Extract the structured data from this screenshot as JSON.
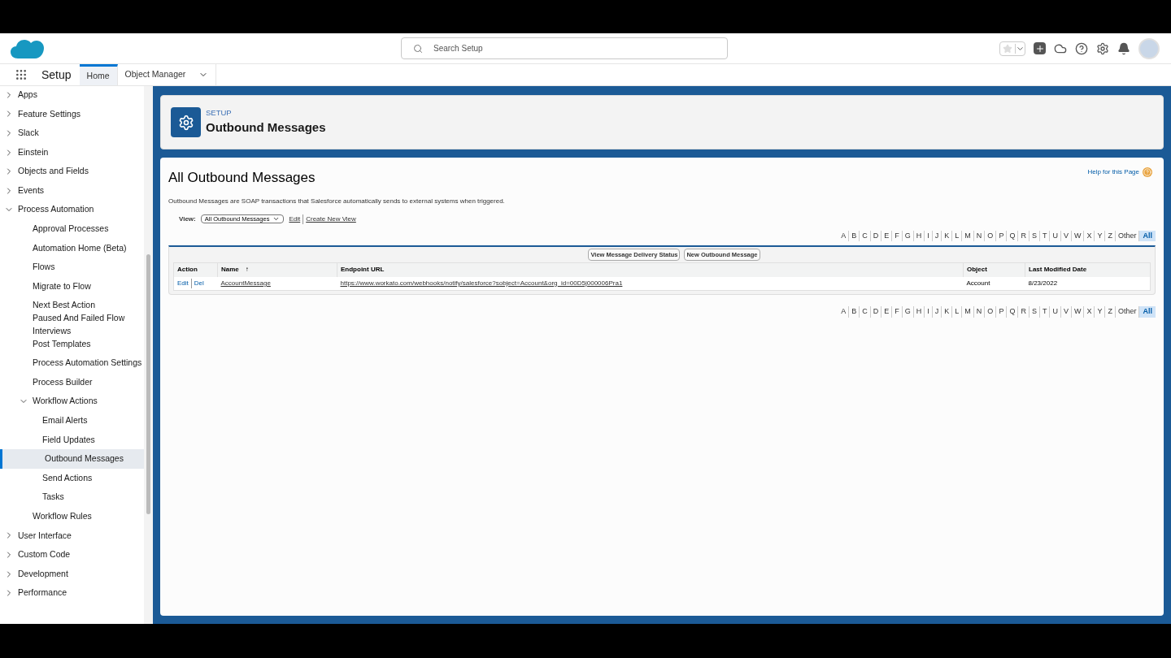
{
  "header": {
    "search": {
      "placeholder": "Search Setup"
    }
  },
  "nav": {
    "app_name": "Setup",
    "tabs": [
      {
        "label": "Home",
        "selected": true,
        "has_menu": false
      },
      {
        "label": "Object Manager",
        "selected": false,
        "has_menu": true
      }
    ]
  },
  "sidebar": {
    "items": [
      {
        "label": "Apps",
        "expanded": false,
        "selected": false
      },
      {
        "label": "Feature Settings",
        "expanded": false,
        "selected": false
      },
      {
        "label": "Slack",
        "expanded": false,
        "selected": false
      },
      {
        "label": "Einstein",
        "expanded": false,
        "selected": false
      },
      {
        "label": "Objects and Fields",
        "expanded": false,
        "selected": false
      },
      {
        "label": "Events",
        "expanded": false,
        "selected": false
      },
      {
        "label": "Process Automation",
        "expanded": true,
        "selected": false,
        "children": [
          {
            "label": "Approval Processes",
            "selected": false
          },
          {
            "label": "Automation Home (Beta)",
            "selected": false
          },
          {
            "label": "Flows",
            "selected": false
          },
          {
            "label": "Migrate to Flow",
            "selected": false
          },
          {
            "label": "Next Best Action",
            "selected": false
          },
          {
            "label": "Paused And Failed Flow Interviews",
            "selected": false
          },
          {
            "label": "Post Templates",
            "selected": false
          },
          {
            "label": "Process Automation Settings",
            "selected": false
          },
          {
            "label": "Process Builder",
            "selected": false
          },
          {
            "label": "Workflow Actions",
            "expanded": true,
            "selected": false,
            "children": [
              {
                "label": "Email Alerts",
                "selected": false
              },
              {
                "label": "Field Updates",
                "selected": false
              },
              {
                "label": "Outbound Messages",
                "selected": true
              },
              {
                "label": "Send Actions",
                "selected": false
              },
              {
                "label": "Tasks",
                "selected": false
              }
            ]
          },
          {
            "label": "Workflow Rules",
            "selected": false
          }
        ]
      },
      {
        "label": "User Interface",
        "expanded": false,
        "selected": false
      },
      {
        "label": "Custom Code",
        "expanded": false,
        "selected": false
      },
      {
        "label": "Development",
        "expanded": false,
        "selected": false
      },
      {
        "label": "Performance",
        "expanded": false,
        "selected": false
      }
    ]
  },
  "page_header": {
    "eyebrow": "SETUP",
    "title": "Outbound Messages"
  },
  "content": {
    "title": "All Outbound Messages",
    "help_link": "Help for this Page",
    "description": "Outbound Messages are SOAP transactions that Salesforce automatically sends to external systems when triggered.",
    "view": {
      "label": "View:",
      "value": "All Outbound Messages",
      "links": [
        "Edit",
        "Create New View"
      ]
    },
    "alphabet_top": [
      {
        "label": "A",
        "selected": false
      },
      {
        "label": "B",
        "selected": false
      },
      {
        "label": "C",
        "selected": false
      },
      {
        "label": "D",
        "selected": false
      },
      {
        "label": "E",
        "selected": false
      },
      {
        "label": "F",
        "selected": false
      },
      {
        "label": "G",
        "selected": false
      },
      {
        "label": "H",
        "selected": false
      },
      {
        "label": "I",
        "selected": false
      },
      {
        "label": "J",
        "selected": false
      },
      {
        "label": "K",
        "selected": false
      },
      {
        "label": "L",
        "selected": false
      },
      {
        "label": "M",
        "selected": false
      },
      {
        "label": "N",
        "selected": false
      },
      {
        "label": "O",
        "selected": false
      },
      {
        "label": "P",
        "selected": false
      },
      {
        "label": "Q",
        "selected": false
      },
      {
        "label": "R",
        "selected": false
      },
      {
        "label": "S",
        "selected": false
      },
      {
        "label": "T",
        "selected": false
      },
      {
        "label": "U",
        "selected": false
      },
      {
        "label": "V",
        "selected": false
      },
      {
        "label": "W",
        "selected": false
      },
      {
        "label": "X",
        "selected": false
      },
      {
        "label": "Y",
        "selected": false
      },
      {
        "label": "Z",
        "selected": false
      },
      {
        "label": "Other",
        "selected": false
      },
      {
        "label": "All",
        "selected": true
      }
    ],
    "buttons": [
      "View Message Delivery Status",
      "New Outbound Message"
    ],
    "table": {
      "columns": [
        {
          "label": "Action"
        },
        {
          "label": "Name",
          "sort": "↑"
        },
        {
          "label": "Endpoint URL"
        },
        {
          "label": "Object"
        },
        {
          "label": "Last Modified Date"
        }
      ],
      "rows": [
        {
          "actions": [
            "Edit",
            "Del"
          ],
          "name": "AccountMessage",
          "endpoint_url": "https://www.workato.com/webhooks/notify/salesforce?sobject=Account&org_id=00D5j000006Pra1",
          "object": "Account",
          "last_modified": "8/23/2022"
        }
      ]
    },
    "alphabet_bottom": [
      {
        "label": "A",
        "selected": false
      },
      {
        "label": "B",
        "selected": false
      },
      {
        "label": "C",
        "selected": false
      },
      {
        "label": "D",
        "selected": false
      },
      {
        "label": "E",
        "selected": false
      },
      {
        "label": "F",
        "selected": false
      },
      {
        "label": "G",
        "selected": false
      },
      {
        "label": "H",
        "selected": false
      },
      {
        "label": "I",
        "selected": false
      },
      {
        "label": "J",
        "selected": false
      },
      {
        "label": "K",
        "selected": false
      },
      {
        "label": "L",
        "selected": false
      },
      {
        "label": "M",
        "selected": false
      },
      {
        "label": "N",
        "selected": false
      },
      {
        "label": "O",
        "selected": false
      },
      {
        "label": "P",
        "selected": false
      },
      {
        "label": "Q",
        "selected": false
      },
      {
        "label": "R",
        "selected": false
      },
      {
        "label": "S",
        "selected": false
      },
      {
        "label": "T",
        "selected": false
      },
      {
        "label": "U",
        "selected": false
      },
      {
        "label": "V",
        "selected": false
      },
      {
        "label": "W",
        "selected": false
      },
      {
        "label": "X",
        "selected": false
      },
      {
        "label": "Y",
        "selected": false
      },
      {
        "label": "Z",
        "selected": false
      },
      {
        "label": "Other",
        "selected": false
      },
      {
        "label": "All",
        "selected": true
      }
    ]
  }
}
